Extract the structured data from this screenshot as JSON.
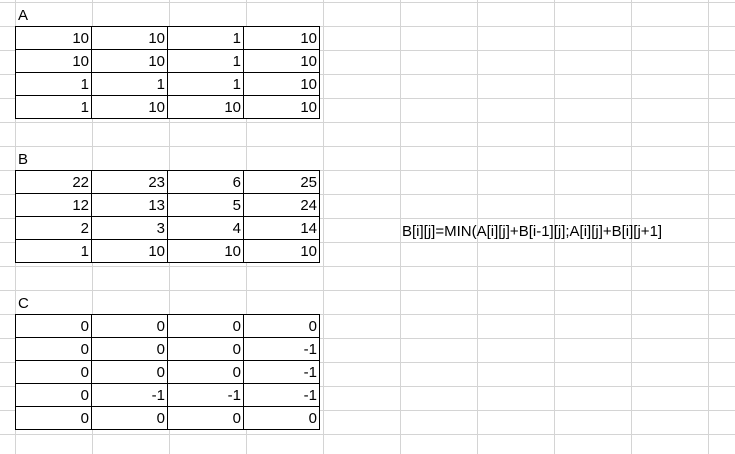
{
  "sheet": {
    "A": {
      "label": "A",
      "rows": [
        [
          "10",
          "10",
          "1",
          "10"
        ],
        [
          "10",
          "10",
          "1",
          "10"
        ],
        [
          "1",
          "1",
          "1",
          "10"
        ],
        [
          "1",
          "10",
          "10",
          "10"
        ]
      ]
    },
    "B": {
      "label": "B",
      "rows": [
        [
          "22",
          "23",
          "6",
          "25"
        ],
        [
          "12",
          "13",
          "5",
          "24"
        ],
        [
          "2",
          "3",
          "4",
          "14"
        ],
        [
          "1",
          "10",
          "10",
          "10"
        ]
      ]
    },
    "C": {
      "label": "C",
      "rows": [
        [
          "0",
          "0",
          "0",
          "0"
        ],
        [
          "0",
          "0",
          "0",
          "-1"
        ],
        [
          "0",
          "0",
          "0",
          "-1"
        ],
        [
          "0",
          "-1",
          "-1",
          "-1"
        ],
        [
          "0",
          "0",
          "0",
          "0"
        ]
      ]
    },
    "formula": "B[i][j]=MIN(A[i][j]+B[i-1][j];A[i][j]+B[i][j+1]"
  }
}
